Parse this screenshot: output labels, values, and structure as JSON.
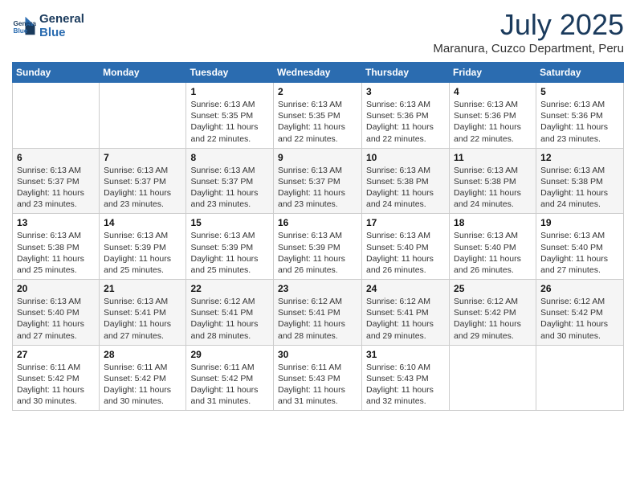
{
  "logo": {
    "line1": "General",
    "line2": "Blue"
  },
  "title": "July 2025",
  "location": "Maranura, Cuzco Department, Peru",
  "weekdays": [
    "Sunday",
    "Monday",
    "Tuesday",
    "Wednesday",
    "Thursday",
    "Friday",
    "Saturday"
  ],
  "weeks": [
    [
      {
        "day": null
      },
      {
        "day": null
      },
      {
        "day": "1",
        "sunrise": "Sunrise: 6:13 AM",
        "sunset": "Sunset: 5:35 PM",
        "daylight": "Daylight: 11 hours and 22 minutes."
      },
      {
        "day": "2",
        "sunrise": "Sunrise: 6:13 AM",
        "sunset": "Sunset: 5:35 PM",
        "daylight": "Daylight: 11 hours and 22 minutes."
      },
      {
        "day": "3",
        "sunrise": "Sunrise: 6:13 AM",
        "sunset": "Sunset: 5:36 PM",
        "daylight": "Daylight: 11 hours and 22 minutes."
      },
      {
        "day": "4",
        "sunrise": "Sunrise: 6:13 AM",
        "sunset": "Sunset: 5:36 PM",
        "daylight": "Daylight: 11 hours and 22 minutes."
      },
      {
        "day": "5",
        "sunrise": "Sunrise: 6:13 AM",
        "sunset": "Sunset: 5:36 PM",
        "daylight": "Daylight: 11 hours and 23 minutes."
      }
    ],
    [
      {
        "day": "6",
        "sunrise": "Sunrise: 6:13 AM",
        "sunset": "Sunset: 5:37 PM",
        "daylight": "Daylight: 11 hours and 23 minutes."
      },
      {
        "day": "7",
        "sunrise": "Sunrise: 6:13 AM",
        "sunset": "Sunset: 5:37 PM",
        "daylight": "Daylight: 11 hours and 23 minutes."
      },
      {
        "day": "8",
        "sunrise": "Sunrise: 6:13 AM",
        "sunset": "Sunset: 5:37 PM",
        "daylight": "Daylight: 11 hours and 23 minutes."
      },
      {
        "day": "9",
        "sunrise": "Sunrise: 6:13 AM",
        "sunset": "Sunset: 5:37 PM",
        "daylight": "Daylight: 11 hours and 23 minutes."
      },
      {
        "day": "10",
        "sunrise": "Sunrise: 6:13 AM",
        "sunset": "Sunset: 5:38 PM",
        "daylight": "Daylight: 11 hours and 24 minutes."
      },
      {
        "day": "11",
        "sunrise": "Sunrise: 6:13 AM",
        "sunset": "Sunset: 5:38 PM",
        "daylight": "Daylight: 11 hours and 24 minutes."
      },
      {
        "day": "12",
        "sunrise": "Sunrise: 6:13 AM",
        "sunset": "Sunset: 5:38 PM",
        "daylight": "Daylight: 11 hours and 24 minutes."
      }
    ],
    [
      {
        "day": "13",
        "sunrise": "Sunrise: 6:13 AM",
        "sunset": "Sunset: 5:38 PM",
        "daylight": "Daylight: 11 hours and 25 minutes."
      },
      {
        "day": "14",
        "sunrise": "Sunrise: 6:13 AM",
        "sunset": "Sunset: 5:39 PM",
        "daylight": "Daylight: 11 hours and 25 minutes."
      },
      {
        "day": "15",
        "sunrise": "Sunrise: 6:13 AM",
        "sunset": "Sunset: 5:39 PM",
        "daylight": "Daylight: 11 hours and 25 minutes."
      },
      {
        "day": "16",
        "sunrise": "Sunrise: 6:13 AM",
        "sunset": "Sunset: 5:39 PM",
        "daylight": "Daylight: 11 hours and 26 minutes."
      },
      {
        "day": "17",
        "sunrise": "Sunrise: 6:13 AM",
        "sunset": "Sunset: 5:40 PM",
        "daylight": "Daylight: 11 hours and 26 minutes."
      },
      {
        "day": "18",
        "sunrise": "Sunrise: 6:13 AM",
        "sunset": "Sunset: 5:40 PM",
        "daylight": "Daylight: 11 hours and 26 minutes."
      },
      {
        "day": "19",
        "sunrise": "Sunrise: 6:13 AM",
        "sunset": "Sunset: 5:40 PM",
        "daylight": "Daylight: 11 hours and 27 minutes."
      }
    ],
    [
      {
        "day": "20",
        "sunrise": "Sunrise: 6:13 AM",
        "sunset": "Sunset: 5:40 PM",
        "daylight": "Daylight: 11 hours and 27 minutes."
      },
      {
        "day": "21",
        "sunrise": "Sunrise: 6:13 AM",
        "sunset": "Sunset: 5:41 PM",
        "daylight": "Daylight: 11 hours and 27 minutes."
      },
      {
        "day": "22",
        "sunrise": "Sunrise: 6:12 AM",
        "sunset": "Sunset: 5:41 PM",
        "daylight": "Daylight: 11 hours and 28 minutes."
      },
      {
        "day": "23",
        "sunrise": "Sunrise: 6:12 AM",
        "sunset": "Sunset: 5:41 PM",
        "daylight": "Daylight: 11 hours and 28 minutes."
      },
      {
        "day": "24",
        "sunrise": "Sunrise: 6:12 AM",
        "sunset": "Sunset: 5:41 PM",
        "daylight": "Daylight: 11 hours and 29 minutes."
      },
      {
        "day": "25",
        "sunrise": "Sunrise: 6:12 AM",
        "sunset": "Sunset: 5:42 PM",
        "daylight": "Daylight: 11 hours and 29 minutes."
      },
      {
        "day": "26",
        "sunrise": "Sunrise: 6:12 AM",
        "sunset": "Sunset: 5:42 PM",
        "daylight": "Daylight: 11 hours and 30 minutes."
      }
    ],
    [
      {
        "day": "27",
        "sunrise": "Sunrise: 6:11 AM",
        "sunset": "Sunset: 5:42 PM",
        "daylight": "Daylight: 11 hours and 30 minutes."
      },
      {
        "day": "28",
        "sunrise": "Sunrise: 6:11 AM",
        "sunset": "Sunset: 5:42 PM",
        "daylight": "Daylight: 11 hours and 30 minutes."
      },
      {
        "day": "29",
        "sunrise": "Sunrise: 6:11 AM",
        "sunset": "Sunset: 5:42 PM",
        "daylight": "Daylight: 11 hours and 31 minutes."
      },
      {
        "day": "30",
        "sunrise": "Sunrise: 6:11 AM",
        "sunset": "Sunset: 5:43 PM",
        "daylight": "Daylight: 11 hours and 31 minutes."
      },
      {
        "day": "31",
        "sunrise": "Sunrise: 6:10 AM",
        "sunset": "Sunset: 5:43 PM",
        "daylight": "Daylight: 11 hours and 32 minutes."
      },
      {
        "day": null
      },
      {
        "day": null
      }
    ]
  ]
}
